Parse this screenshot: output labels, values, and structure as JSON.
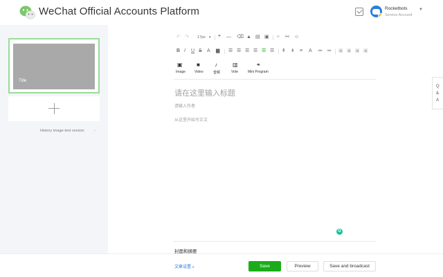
{
  "header": {
    "title": "WeChat Official Accounts Platform",
    "account_name": "Rocketbots",
    "account_type": "Service Account"
  },
  "left_panel": {
    "article_title": "Title",
    "history_link": "History image-text version"
  },
  "toolbar": {
    "font_size": "17px",
    "insert_items": [
      {
        "label": "Image",
        "icon": "image-icon"
      },
      {
        "label": "Video",
        "icon": "video-icon"
      },
      {
        "label": "音频",
        "icon": "microphone-icon"
      },
      {
        "label": "Vote",
        "icon": "vote-icon"
      },
      {
        "label": "Mini Program",
        "icon": "link-icon"
      }
    ]
  },
  "editor": {
    "title_placeholder": "请在这里输入标题",
    "author_placeholder": "请输入作者",
    "body_placeholder": "从这里开始写正文",
    "cover_section": "封面和摘要"
  },
  "side_tab": {
    "chars": [
      "Q",
      "&",
      "A"
    ]
  },
  "footer": {
    "article_settings": "文章设置",
    "save": "Save",
    "preview": "Preview",
    "save_broadcast": "Save and broadcast"
  },
  "colors": {
    "brand_green": "#1aad19",
    "selected_border": "#95dd95",
    "link_blue": "#2b7de0",
    "panel_bg": "#f4f5f9"
  }
}
